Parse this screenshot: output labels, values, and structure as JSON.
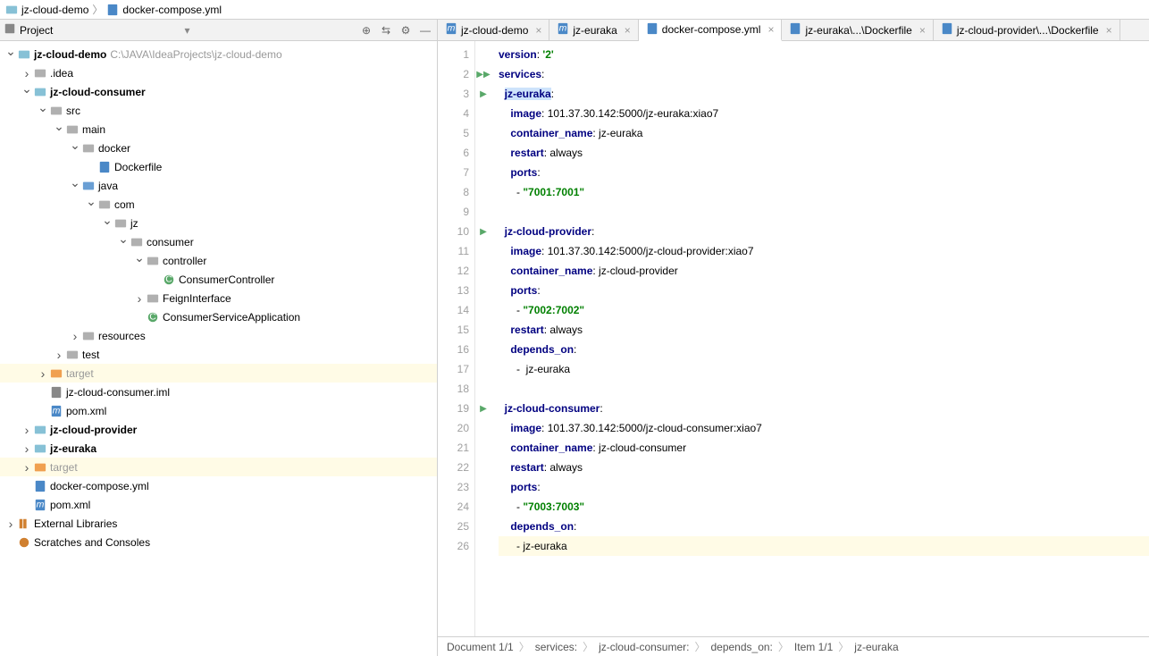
{
  "breadcrumb": {
    "root": "jz-cloud-demo",
    "file": "docker-compose.yml"
  },
  "projectPanel": {
    "label": "Project"
  },
  "tree": {
    "root": {
      "name": "jz-cloud-demo",
      "path": "C:\\JAVA\\IdeaProjects\\jz-cloud-demo"
    },
    "idea": ".idea",
    "consumer": "jz-cloud-consumer",
    "src": "src",
    "main": "main",
    "docker": "docker",
    "dockerfile": "Dockerfile",
    "java": "java",
    "com": "com",
    "jz": "jz",
    "consumerPkg": "consumer",
    "controller": "controller",
    "consumerController": "ConsumerController",
    "feign": "FeignInterface",
    "consumerApp": "ConsumerServiceApplication",
    "resources": "resources",
    "test": "test",
    "targetMod": "target",
    "iml": "jz-cloud-consumer.iml",
    "pomMod": "pom.xml",
    "provider": "jz-cloud-provider",
    "euraka": "jz-euraka",
    "targetRoot": "target",
    "compose": "docker-compose.yml",
    "pomRoot": "pom.xml",
    "extLibs": "External Libraries",
    "scratches": "Scratches and Consoles"
  },
  "tabs": [
    {
      "label": "jz-cloud-demo",
      "icon": "m",
      "active": false
    },
    {
      "label": "jz-euraka",
      "icon": "m",
      "active": false
    },
    {
      "label": "docker-compose.yml",
      "icon": "dc",
      "active": true
    },
    {
      "label": "jz-euraka\\...\\Dockerfile",
      "icon": "dc",
      "active": false
    },
    {
      "label": "jz-cloud-provider\\...\\Dockerfile",
      "icon": "dc",
      "active": false
    }
  ],
  "code": {
    "lines": [
      {
        "n": 1,
        "seg": [
          {
            "t": "version",
            "c": "k"
          },
          {
            "t": ": ",
            "c": "n"
          },
          {
            "t": "'2'",
            "c": "s"
          }
        ]
      },
      {
        "n": 2,
        "mark": "dplay",
        "seg": [
          {
            "t": "services",
            "c": "k"
          },
          {
            "t": ":",
            "c": "n"
          }
        ]
      },
      {
        "n": 3,
        "mark": "play",
        "seg": [
          {
            "t": "  ",
            "c": "n"
          },
          {
            "t": "jz-euraka",
            "c": "k",
            "sel": true
          },
          {
            "t": ":",
            "c": "n"
          }
        ]
      },
      {
        "n": 4,
        "seg": [
          {
            "t": "    ",
            "c": "n"
          },
          {
            "t": "image",
            "c": "k"
          },
          {
            "t": ": 101.37.30.142:5000/jz-euraka:xiao7",
            "c": "n"
          }
        ]
      },
      {
        "n": 5,
        "seg": [
          {
            "t": "    ",
            "c": "n"
          },
          {
            "t": "container_name",
            "c": "k"
          },
          {
            "t": ": jz-euraka",
            "c": "n"
          }
        ]
      },
      {
        "n": 6,
        "seg": [
          {
            "t": "    ",
            "c": "n"
          },
          {
            "t": "restart",
            "c": "k"
          },
          {
            "t": ": always",
            "c": "n"
          }
        ]
      },
      {
        "n": 7,
        "seg": [
          {
            "t": "    ",
            "c": "n"
          },
          {
            "t": "ports",
            "c": "k"
          },
          {
            "t": ":",
            "c": "n"
          }
        ]
      },
      {
        "n": 8,
        "seg": [
          {
            "t": "      - ",
            "c": "n"
          },
          {
            "t": "\"7001:7001\"",
            "c": "s"
          }
        ]
      },
      {
        "n": 9,
        "seg": [
          {
            "t": "",
            "c": "n"
          }
        ]
      },
      {
        "n": 10,
        "mark": "play",
        "seg": [
          {
            "t": "  ",
            "c": "n"
          },
          {
            "t": "jz-cloud-provider",
            "c": "k"
          },
          {
            "t": ":",
            "c": "n"
          }
        ]
      },
      {
        "n": 11,
        "seg": [
          {
            "t": "    ",
            "c": "n"
          },
          {
            "t": "image",
            "c": "k"
          },
          {
            "t": ": 101.37.30.142:5000/jz-cloud-provider:xiao7",
            "c": "n"
          }
        ]
      },
      {
        "n": 12,
        "seg": [
          {
            "t": "    ",
            "c": "n"
          },
          {
            "t": "container_name",
            "c": "k"
          },
          {
            "t": ": jz-cloud-provider",
            "c": "n"
          }
        ]
      },
      {
        "n": 13,
        "seg": [
          {
            "t": "    ",
            "c": "n"
          },
          {
            "t": "ports",
            "c": "k"
          },
          {
            "t": ":",
            "c": "n"
          }
        ]
      },
      {
        "n": 14,
        "seg": [
          {
            "t": "      - ",
            "c": "n"
          },
          {
            "t": "\"7002:7002\"",
            "c": "s"
          }
        ]
      },
      {
        "n": 15,
        "seg": [
          {
            "t": "    ",
            "c": "n"
          },
          {
            "t": "restart",
            "c": "k"
          },
          {
            "t": ": always",
            "c": "n"
          }
        ]
      },
      {
        "n": 16,
        "seg": [
          {
            "t": "    ",
            "c": "n"
          },
          {
            "t": "depends_on",
            "c": "k"
          },
          {
            "t": ":",
            "c": "n"
          }
        ]
      },
      {
        "n": 17,
        "seg": [
          {
            "t": "      -  jz-euraka",
            "c": "n"
          }
        ]
      },
      {
        "n": 18,
        "seg": [
          {
            "t": "",
            "c": "n"
          }
        ]
      },
      {
        "n": 19,
        "mark": "play",
        "seg": [
          {
            "t": "  ",
            "c": "n"
          },
          {
            "t": "jz-cloud-consumer",
            "c": "k"
          },
          {
            "t": ":",
            "c": "n"
          }
        ]
      },
      {
        "n": 20,
        "seg": [
          {
            "t": "    ",
            "c": "n"
          },
          {
            "t": "image",
            "c": "k"
          },
          {
            "t": ": 101.37.30.142:5000/jz-cloud-consumer:xiao7",
            "c": "n"
          }
        ]
      },
      {
        "n": 21,
        "seg": [
          {
            "t": "    ",
            "c": "n"
          },
          {
            "t": "container_name",
            "c": "k"
          },
          {
            "t": ": jz-cloud-consumer",
            "c": "n"
          }
        ]
      },
      {
        "n": 22,
        "seg": [
          {
            "t": "    ",
            "c": "n"
          },
          {
            "t": "restart",
            "c": "k"
          },
          {
            "t": ": always",
            "c": "n"
          }
        ]
      },
      {
        "n": 23,
        "seg": [
          {
            "t": "    ",
            "c": "n"
          },
          {
            "t": "ports",
            "c": "k"
          },
          {
            "t": ":",
            "c": "n"
          }
        ]
      },
      {
        "n": 24,
        "seg": [
          {
            "t": "      - ",
            "c": "n"
          },
          {
            "t": "\"7003:7003\"",
            "c": "s"
          }
        ]
      },
      {
        "n": 25,
        "seg": [
          {
            "t": "    ",
            "c": "n"
          },
          {
            "t": "depends_on",
            "c": "k"
          },
          {
            "t": ":",
            "c": "n"
          }
        ]
      },
      {
        "n": 26,
        "hl": true,
        "seg": [
          {
            "t": "      - jz-euraka",
            "c": "n"
          }
        ]
      }
    ]
  },
  "status": {
    "doc": "Document 1/1",
    "p1": "services:",
    "p2": "jz-cloud-consumer:",
    "p3": "depends_on:",
    "p4": "Item 1/1",
    "p5": "jz-euraka"
  }
}
